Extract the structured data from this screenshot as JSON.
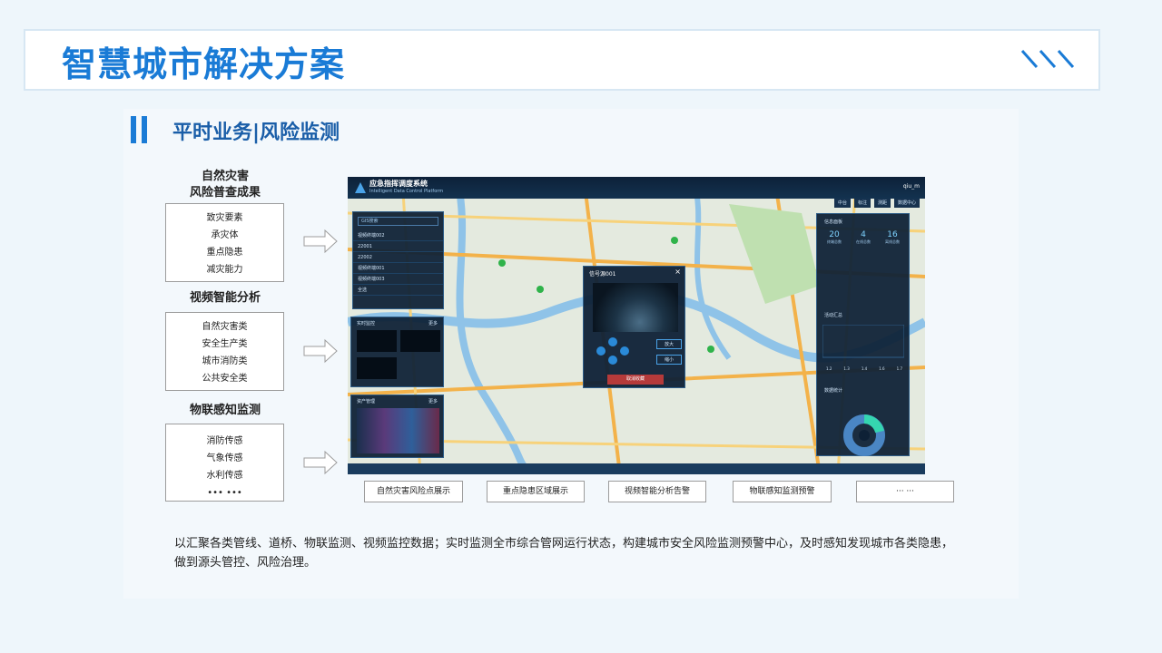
{
  "header": {
    "title": "智慧城市解决方案"
  },
  "section": {
    "title": "平时业务|风险监测"
  },
  "groups": [
    {
      "title": "自然灾害\n风险普查成果",
      "items": [
        "致灾要素",
        "承灾体",
        "重点隐患",
        "减灾能力"
      ]
    },
    {
      "title": "视频智能分析",
      "items": [
        "自然灾害类",
        "安全生产类",
        "城市消防类",
        "公共安全类"
      ]
    },
    {
      "title": "物联感知监测",
      "items": [
        "消防传感",
        "气象传感",
        "水利传感",
        "••• •••"
      ]
    }
  ],
  "screenshot": {
    "app_title": "应急指挥调度系统",
    "app_subtitle": "Intelligent Data Control Platform",
    "user": "qiu_m",
    "tabs": [
      "中台",
      "标注",
      "测距",
      "数据中心"
    ],
    "search_placeholder": "GIS搜索",
    "list_items": [
      "视频终端002",
      "22001",
      "22002",
      "视频终端001",
      "视频终端003",
      "全选"
    ],
    "panel_realtime": "实时监控",
    "panel_assets": "资产管理",
    "more": "更多",
    "popup_title": "信号源001",
    "popup_zoom_in": "放大",
    "popup_zoom_out": "缩小",
    "popup_cancel": "取消收藏",
    "right_title": "信息面板",
    "stats": [
      {
        "value": "20",
        "label": "终端总数"
      },
      {
        "value": "4",
        "label": "在线总数"
      },
      {
        "value": "16",
        "label": "离线总数"
      }
    ],
    "activity_title": "活动汇总",
    "activity_ticks": [
      "1.2",
      "1.3",
      "1.4",
      "1.6",
      "1.7"
    ],
    "data_title": "数据统计"
  },
  "captions": [
    "自然灾害风险点展示",
    "重点隐患区域展示",
    "视频智能分析告警",
    "物联感知监测预警",
    "··· ···"
  ],
  "description": "以汇聚各类管线、道桥、物联监测、视频监控数据；实时监测全市综合管网运行状态，构建城市安全风险监测预警中心，及时感知发现城市各类隐患，做到源头管控、风险治理。",
  "colors": {
    "accent": "#1a7bd6",
    "heading": "#1a5ea8",
    "dark_panel": "#0e2136"
  }
}
